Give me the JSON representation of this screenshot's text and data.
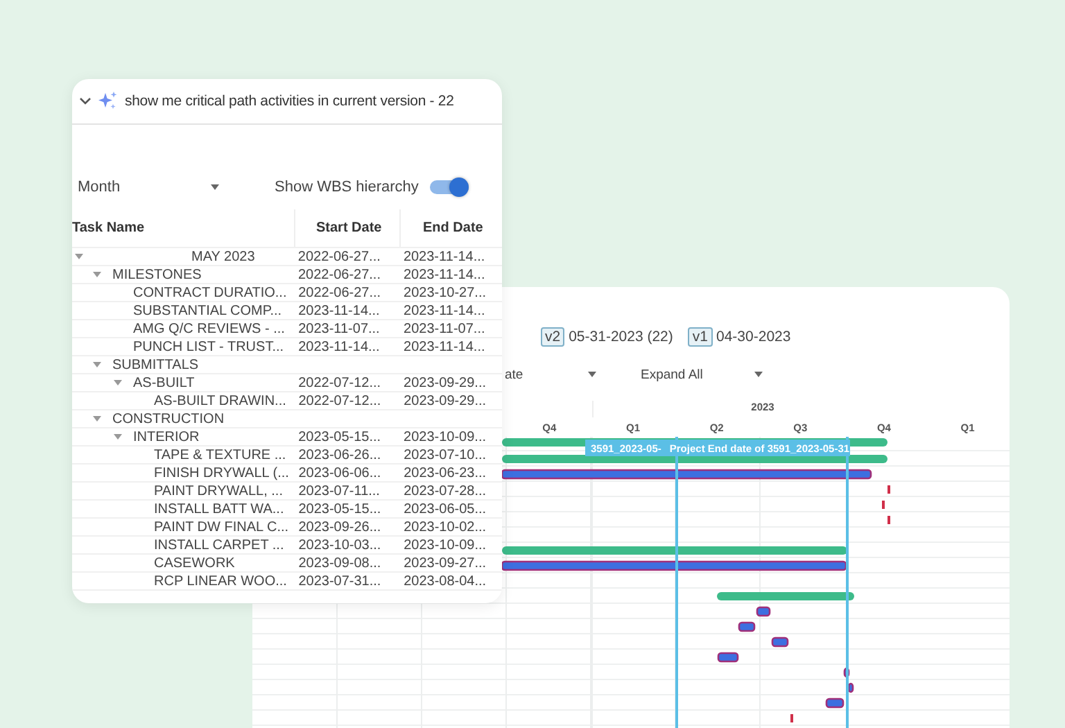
{
  "query_panel": {
    "title": "show me critical path activities in current version - 22",
    "period_dropdown": {
      "value": "Month"
    },
    "wbs_toggle": {
      "label": "Show WBS hierarchy",
      "on": true
    },
    "table": {
      "columns": [
        "Task Name",
        "Start Date",
        "End Date"
      ],
      "rows": [
        {
          "name": "MAY 2023",
          "start": "2022-06-27...",
          "end": "2023-11-14...",
          "expanded": true,
          "children": [
            {
              "name": "MILESTONES",
              "start": "2022-06-27...",
              "end": "2023-11-14...",
              "expanded": true,
              "children": [
                {
                  "name": "CONTRACT DURATIO...",
                  "start": "2022-06-27...",
                  "end": "2023-10-27..."
                },
                {
                  "name": "SUBSTANTIAL COMP...",
                  "start": "2023-11-14...",
                  "end": "2023-11-14..."
                },
                {
                  "name": "AMG Q/C REVIEWS - ...",
                  "start": "2023-11-07...",
                  "end": "2023-11-07..."
                },
                {
                  "name": "PUNCH LIST - TRUST...",
                  "start": "2023-11-14...",
                  "end": "2023-11-14..."
                }
              ]
            },
            {
              "name": "SUBMITTALS",
              "expanded": true,
              "children": [
                {
                  "name": "AS-BUILT",
                  "start": "2022-07-12...",
                  "end": "2023-09-29...",
                  "expanded": true,
                  "children": [
                    {
                      "name": "AS-BUILT DRAWIN...",
                      "start": "2022-07-12...",
                      "end": "2023-09-29..."
                    }
                  ]
                }
              ]
            },
            {
              "name": "CONSTRUCTION",
              "expanded": true,
              "children": [
                {
                  "name": "INTERIOR",
                  "start": "2023-05-15...",
                  "end": "2023-10-09...",
                  "expanded": true,
                  "children": [
                    {
                      "name": "TAPE & TEXTURE ...",
                      "start": "2023-06-26...",
                      "end": "2023-07-10..."
                    },
                    {
                      "name": "FINISH DRYWALL (...",
                      "start": "2023-06-06...",
                      "end": "2023-06-23..."
                    },
                    {
                      "name": "PAINT DRYWALL, ...",
                      "start": "2023-07-11...",
                      "end": "2023-07-28..."
                    },
                    {
                      "name": "INSTALL BATT WA...",
                      "start": "2023-05-15...",
                      "end": "2023-06-05..."
                    },
                    {
                      "name": "PAINT DW FINAL C...",
                      "start": "2023-09-26...",
                      "end": "2023-10-02..."
                    },
                    {
                      "name": "INSTALL CARPET ...",
                      "start": "2023-10-03...",
                      "end": "2023-10-09..."
                    },
                    {
                      "name": "CASEWORK",
                      "start": "2023-09-08...",
                      "end": "2023-09-27..."
                    },
                    {
                      "name": "RCP LINEAR WOO...",
                      "start": "2023-07-31...",
                      "end": "2023-08-04..."
                    }
                  ]
                }
              ]
            }
          ]
        }
      ]
    }
  },
  "gantt_panel": {
    "versions": [
      {
        "tag": "v2",
        "date": "05-31-2023 (22)"
      },
      {
        "tag": "v1",
        "date": "04-30-2023"
      }
    ],
    "dropdowns": [
      {
        "value": "ate"
      },
      {
        "value": "Expand All"
      }
    ],
    "year": "2023",
    "quarters": [
      "Q4",
      "Q1",
      "Q2",
      "Q3",
      "Q4",
      "Q1"
    ],
    "marker_labels": [
      "3591_2023-05-",
      "Project End date of 3591_2023-05-31"
    ]
  }
}
